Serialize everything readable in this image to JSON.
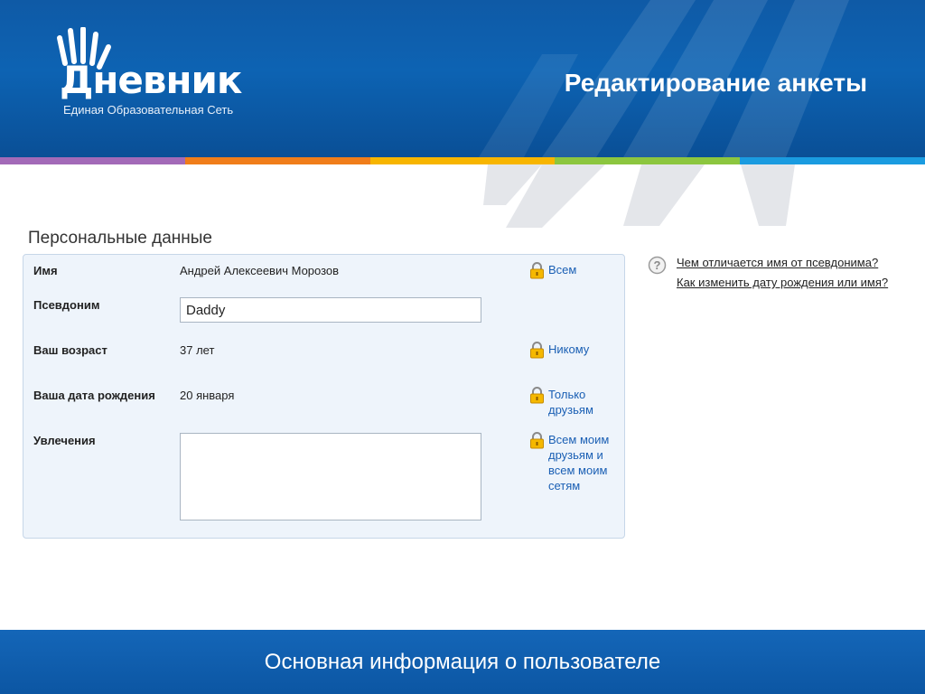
{
  "header": {
    "logo_word": "Дневник",
    "logo_tagline": "Единая Образовательная Сеть",
    "page_title": "Редактирование анкеты"
  },
  "stripe_colors": [
    "#a36ab8",
    "#f07d1a",
    "#f7b500",
    "#8cc63f",
    "#1a9be0"
  ],
  "section": {
    "title": "Персональные данные",
    "fields": {
      "name": {
        "label": "Имя",
        "value": "Андрей Алексеевич Морозов",
        "privacy": "Всем"
      },
      "nickname": {
        "label": "Псевдоним",
        "value": "Daddy"
      },
      "age": {
        "label": "Ваш возраст",
        "value": "37 лет",
        "privacy": "Никому"
      },
      "birthdate": {
        "label": "Ваша дата рождения",
        "value": "20 января",
        "privacy": "Только друзьям"
      },
      "hobbies": {
        "label": "Увлечения",
        "value": "",
        "privacy": "Всем моим друзьям и всем моим сетям"
      }
    }
  },
  "help": {
    "icon": "question-icon",
    "links": [
      "Чем отличается имя от псевдонима?",
      "Как изменить дату рождения или имя?"
    ]
  },
  "footer": {
    "text": "Основная информация о пользователе"
  },
  "colors": {
    "accent": "#0d63b3",
    "link": "#1a5fb4",
    "panel_bg": "#eef4fb",
    "lock": "#f5b800"
  }
}
